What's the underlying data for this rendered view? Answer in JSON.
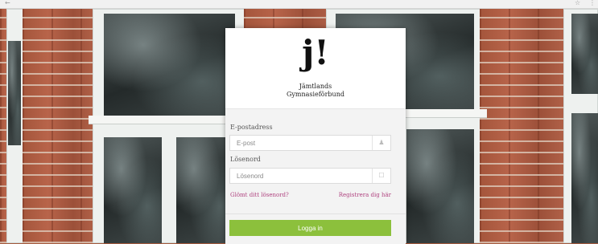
{
  "browser": {
    "left_icon": "←",
    "star_icon": "☆",
    "menu_icon": "⋮"
  },
  "logo": {
    "mark": "j!",
    "line1": "Jämtlands",
    "line2": "Gymnasieförbund"
  },
  "form": {
    "email_label": "E-postadress",
    "email_placeholder": "E-post",
    "email_icon": "user-icon",
    "password_label": "Lösenord",
    "password_placeholder": "Lösenord",
    "password_icon": "lock-icon",
    "forgot_link": "Glömt ditt lösenord?",
    "register_link": "Registrera dig här",
    "login_button": "Logga in"
  },
  "colors": {
    "button": "#8cc03c",
    "link": "#b04480",
    "brick": "#a4553b"
  }
}
